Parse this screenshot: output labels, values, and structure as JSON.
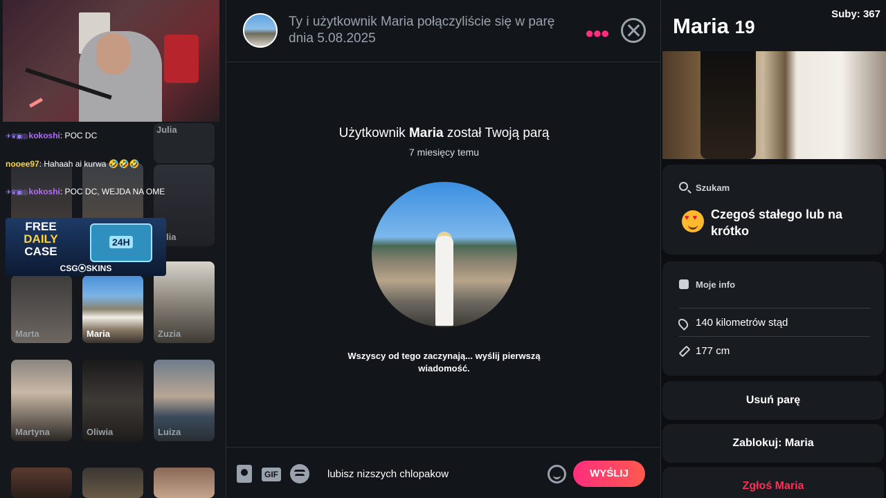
{
  "stream": {
    "chat": [
      {
        "user": "kokoshi",
        "text": ": POC DC",
        "user_color": "#b46cff"
      },
      {
        "user": "nooee97",
        "text": ": Hahaah ai kurwa 🤣🤣🤣",
        "user_color": "#ffd23a"
      },
      {
        "user": "kokoshi",
        "text": ": POC DC, WEJDA NA OME",
        "user_color": "#b46cff"
      }
    ],
    "promo": {
      "line1": "FREE",
      "line2": "DAILY",
      "line3": "CASE",
      "box_label": "24H",
      "brand": "CSG⦿SKINS"
    }
  },
  "grid": {
    "behind_labels": [
      "Julia",
      "lia"
    ],
    "tiles": [
      {
        "name": "Marta",
        "selected": false
      },
      {
        "name": "Maria",
        "selected": true
      },
      {
        "name": "Zuzia",
        "selected": false
      },
      {
        "name": "Martyna",
        "selected": false
      },
      {
        "name": "Oliwia",
        "selected": false
      },
      {
        "name": "Luiza",
        "selected": false
      }
    ]
  },
  "conversation": {
    "header_text": "Ty i użytkownik Maria połączyliście się w parę dnia 5.08.2025",
    "match_prefix": "Użytkownik ",
    "match_name": "Maria",
    "match_suffix": " został Twoją parą",
    "match_time": "7 miesięcy temu",
    "hint": "Wszyscy od tego zaczynają... wyślij pierwszą wiadomość.",
    "input_value": "lubisz nizszych chlopakow",
    "gif_label": "GIF",
    "send_label": "WYŚLIJ"
  },
  "profile": {
    "name": "Maria",
    "age": "19",
    "subs": "Suby: 367",
    "seeking_label": "Szukam",
    "seeking_value": "Czegoś stałego lub na krótko",
    "info_label": "Moje info",
    "distance": "140 kilometrów stąd",
    "height": "177 cm",
    "actions": {
      "unmatch": "Usuń parę",
      "block": "Zablokuj: Maria",
      "report": "Zgłoś Maria"
    }
  },
  "colors": {
    "accent": "#ff2e7e",
    "danger": "#ff2e57",
    "background": "#121519"
  }
}
